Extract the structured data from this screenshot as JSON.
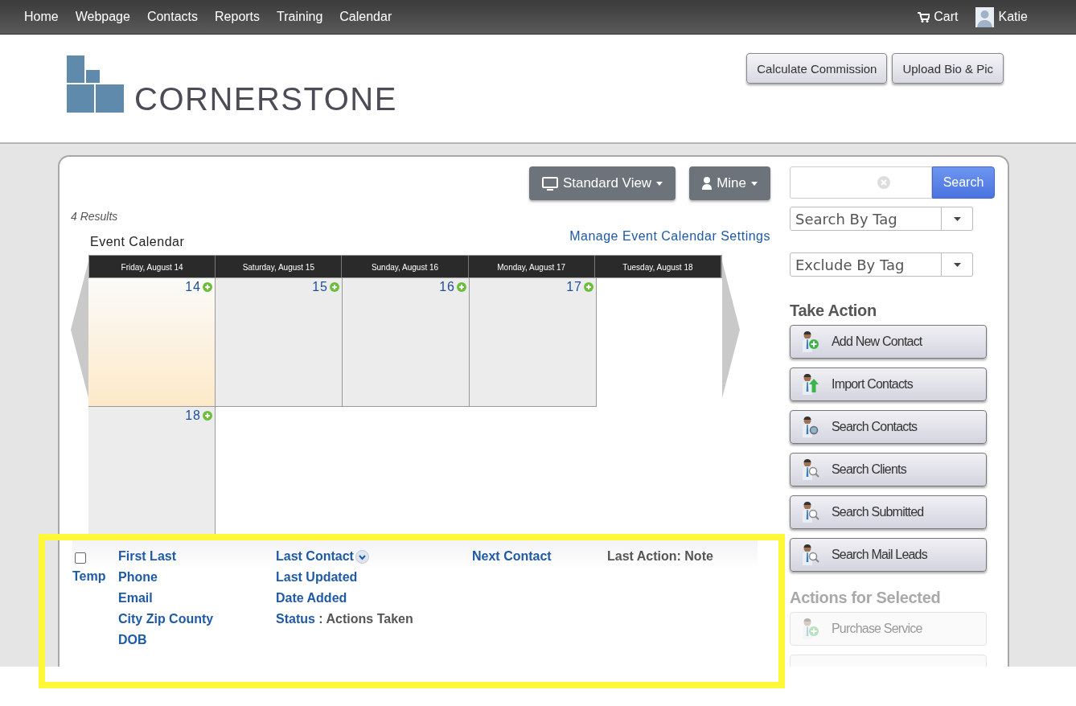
{
  "nav": {
    "items": [
      "Home",
      "Webpage",
      "Contacts",
      "Reports",
      "Training",
      "Calendar"
    ],
    "cart": "Cart",
    "user": "Katie"
  },
  "header": {
    "logo": "CORNERSTONE",
    "buttons": [
      "Calculate Commission",
      "Upload Bio & Pic"
    ]
  },
  "toolbar": {
    "view_button": "Standard View",
    "owner_button": "Mine"
  },
  "results": "4 Results",
  "calendar": {
    "title": "Event Calendar",
    "settings_link": "Manage Event Calendar Settings",
    "headers": [
      "Friday, August 14",
      "Saturday, August 15",
      "Sunday, August 16",
      "Monday, August 17",
      "Tuesday, August 18"
    ],
    "cells": [
      {
        "number": "14",
        "selected": true
      },
      {
        "number": "15",
        "selected": false
      },
      {
        "number": "16",
        "selected": false
      },
      {
        "number": "17",
        "selected": false
      },
      {
        "number": "18",
        "selected": false
      }
    ]
  },
  "list_header": {
    "checkbox": {
      "checked": false
    },
    "columns": [
      {
        "lines": [
          {
            "parts": [
              {
                "text": "Temp",
                "kind": "link"
              }
            ]
          }
        ]
      },
      {
        "lines": [
          {
            "parts": [
              {
                "text": "First Last",
                "kind": "link"
              }
            ]
          },
          {
            "parts": [
              {
                "text": "Phone",
                "kind": "link"
              }
            ]
          },
          {
            "parts": [
              {
                "text": "Email",
                "kind": "link"
              }
            ]
          },
          {
            "parts": [
              {
                "text": "City Zip County",
                "kind": "link"
              }
            ]
          },
          {
            "parts": [
              {
                "text": "DOB",
                "kind": "link"
              }
            ]
          }
        ]
      },
      {
        "lines": [
          {
            "parts": [
              {
                "text": "Last Contact",
                "kind": "link"
              }
            ],
            "sorted": true
          },
          {
            "parts": [
              {
                "text": "Last Updated",
                "kind": "link"
              }
            ]
          },
          {
            "parts": [
              {
                "text": "Date Added",
                "kind": "link"
              }
            ]
          },
          {
            "parts": [
              {
                "text": "Status",
                "kind": "link"
              },
              {
                "text": " : Actions Taken",
                "kind": "label"
              }
            ]
          }
        ]
      },
      {
        "lines": [
          {
            "parts": [
              {
                "text": "Next Contact",
                "kind": "link"
              }
            ]
          }
        ]
      },
      {
        "lines": [
          {
            "parts": [
              {
                "text": "Last Action: Note",
                "kind": "label"
              }
            ]
          }
        ]
      }
    ]
  },
  "sidebar": {
    "search_button": "Search",
    "tag_filters": [
      {
        "placeholder": "Search By Tag"
      },
      {
        "placeholder": "Exclude By Tag"
      }
    ],
    "sections": [
      {
        "title": "Take Action",
        "disabled": false,
        "buttons": [
          {
            "label": "Add New Contact",
            "kind": "add"
          },
          {
            "label": "Import Contacts",
            "kind": "import"
          },
          {
            "label": "Search Contacts",
            "kind": "find"
          },
          {
            "label": "Search Clients",
            "kind": "search"
          },
          {
            "label": "Search Submitted",
            "kind": "search"
          },
          {
            "label": "Search Mail Leads",
            "kind": "search"
          }
        ]
      },
      {
        "title": "Actions for Selected",
        "disabled": true,
        "buttons": [
          {
            "label": "Purchase Service",
            "kind": "add"
          }
        ]
      }
    ]
  }
}
